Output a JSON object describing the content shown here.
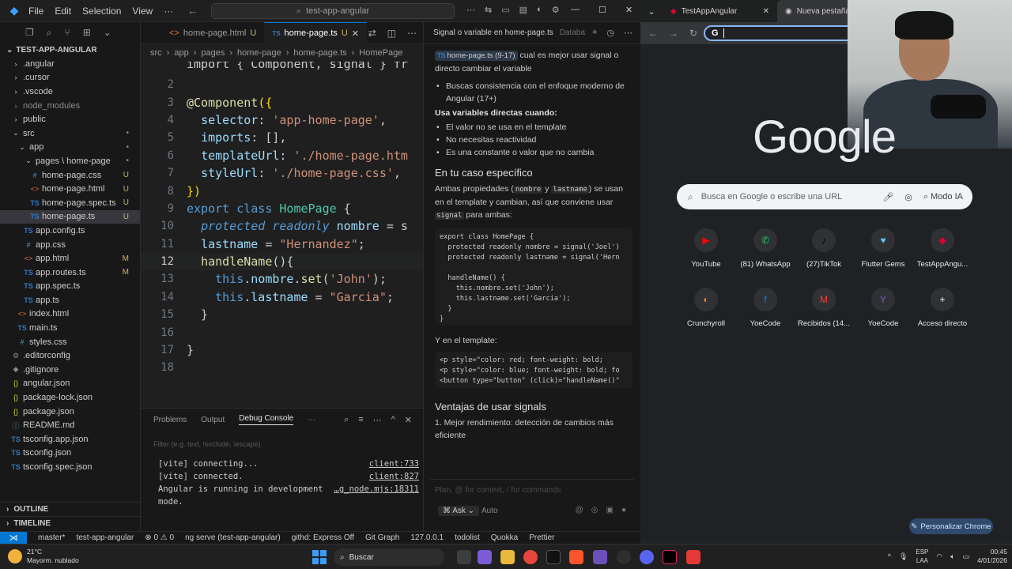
{
  "vscode": {
    "menu": [
      "File",
      "Edit",
      "Selection",
      "View"
    ],
    "command_center": "test-app-angular",
    "tabs": [
      {
        "label": "home-page.html",
        "mark": "U",
        "type": "html"
      },
      {
        "label": "home-page.ts",
        "mark": "U",
        "type": "ts",
        "active": true
      }
    ],
    "breadcrumb": [
      "src",
      "app",
      "pages",
      "home-page",
      "home-page.ts",
      "HomePage"
    ],
    "explorer": {
      "root": "TEST-APP-ANGULAR",
      "items": [
        {
          "label": ".angular",
          "depth": 1,
          "kind": "folder"
        },
        {
          "label": ".cursor",
          "depth": 1,
          "kind": "folder"
        },
        {
          "label": ".vscode",
          "depth": 1,
          "kind": "folder"
        },
        {
          "label": "node_modules",
          "depth": 1,
          "kind": "folder",
          "dim": true
        },
        {
          "label": "public",
          "depth": 1,
          "kind": "folder"
        },
        {
          "label": "src",
          "depth": 1,
          "kind": "folder-open",
          "badge": "•"
        },
        {
          "label": "app",
          "depth": 2,
          "kind": "folder-open",
          "badge": "•"
        },
        {
          "label": "pages \\ home-page",
          "depth": 3,
          "kind": "folder-open",
          "badge": "•"
        },
        {
          "label": "home-page.css",
          "depth": 4,
          "kind": "css",
          "badge": "U"
        },
        {
          "label": "home-page.html",
          "depth": 4,
          "kind": "html",
          "badge": "U"
        },
        {
          "label": "home-page.spec.ts",
          "depth": 4,
          "kind": "ts",
          "badge": "U"
        },
        {
          "label": "home-page.ts",
          "depth": 4,
          "kind": "ts",
          "badge": "U",
          "active": true
        },
        {
          "label": "app.config.ts",
          "depth": 3,
          "kind": "ts"
        },
        {
          "label": "app.css",
          "depth": 3,
          "kind": "css"
        },
        {
          "label": "app.html",
          "depth": 3,
          "kind": "html",
          "badge": "M"
        },
        {
          "label": "app.routes.ts",
          "depth": 3,
          "kind": "ts",
          "badge": "M"
        },
        {
          "label": "app.spec.ts",
          "depth": 3,
          "kind": "ts"
        },
        {
          "label": "app.ts",
          "depth": 3,
          "kind": "ts"
        },
        {
          "label": "index.html",
          "depth": 2,
          "kind": "html"
        },
        {
          "label": "main.ts",
          "depth": 2,
          "kind": "ts"
        },
        {
          "label": "styles.css",
          "depth": 2,
          "kind": "css"
        },
        {
          "label": ".editorconfig",
          "depth": 1,
          "kind": "gear"
        },
        {
          "label": ".gitignore",
          "depth": 1,
          "kind": "git"
        },
        {
          "label": "angular.json",
          "depth": 1,
          "kind": "json"
        },
        {
          "label": "package-lock.json",
          "depth": 1,
          "kind": "json"
        },
        {
          "label": "package.json",
          "depth": 1,
          "kind": "json"
        },
        {
          "label": "README.md",
          "depth": 1,
          "kind": "md"
        },
        {
          "label": "tsconfig.app.json",
          "depth": 1,
          "kind": "tsconfig"
        },
        {
          "label": "tsconfig.json",
          "depth": 1,
          "kind": "tsconfig"
        },
        {
          "label": "tsconfig.spec.json",
          "depth": 1,
          "kind": "tsconfig"
        }
      ],
      "outline": "OUTLINE",
      "timeline": "TIMELINE"
    },
    "code": {
      "top_partial": "import { Component, signal } fr",
      "current_line": 12,
      "lines": [
        {
          "n": 2,
          "html": ""
        },
        {
          "n": 3,
          "html": "<span class='d'>@Component</span><span class='b'>({</span>"
        },
        {
          "n": 4,
          "html": "  <span class='p'>selector</span>: <span class='s'>'app-home-page'</span>,"
        },
        {
          "n": 5,
          "html": "  <span class='p'>imports</span>: [],"
        },
        {
          "n": 6,
          "html": "  <span class='p'>templateUrl</span>: <span class='s'>'./home-page.htm</span>"
        },
        {
          "n": 7,
          "html": "  <span class='p'>styleUrl</span>: <span class='s'>'./home-page.css'</span>,"
        },
        {
          "n": 8,
          "html": "<span class='b'>})</span>"
        },
        {
          "n": 9,
          "html": "<span class='k'>export</span> <span class='k'>class</span> <span class='c'>HomePage</span> {"
        },
        {
          "n": 10,
          "html": "  <span class='i'>protected</span> <span class='i'>readonly</span> <span class='p'>nombre</span> = s"
        },
        {
          "n": 11,
          "html": "  <span class='p'>lastname</span> = <span class='s'>\"Hernandez\"</span>;"
        },
        {
          "n": 12,
          "html": "  <span class='f'>handleName</span>(){"
        },
        {
          "n": 13,
          "html": "    <span class='k'>this</span>.<span class='p'>nombre</span>.<span class='f'>set</span>(<span class='s'>'John'</span>);"
        },
        {
          "n": 14,
          "html": "    <span class='k'>this</span>.<span class='p'>lastname</span> = <span class='s'>\"Garcia\"</span>;"
        },
        {
          "n": 15,
          "html": "  }"
        },
        {
          "n": 16,
          "html": ""
        },
        {
          "n": 17,
          "html": "}"
        },
        {
          "n": 18,
          "html": ""
        }
      ]
    },
    "panel": {
      "tabs": [
        "Problems",
        "Output",
        "Debug Console"
      ],
      "active_tab": "Debug Console",
      "filter_placeholder": "Filter (e.g. text, !exclude, \\escape)",
      "output": [
        {
          "text": "[vite] connecting...",
          "link": "client:733"
        },
        {
          "text": "[vite] connected.",
          "link": "client:827"
        },
        {
          "text": "Angular is running in development",
          "link": "…g_node.mjs:18311"
        },
        {
          "text": "mode.",
          "link": ""
        }
      ]
    },
    "chat": {
      "title": "Signal o variable en home-page.ts",
      "title_extra": "Databa",
      "ref_chip": "home-page.ts (9-17)",
      "question": "cual es mejor usar signal o directo cambiar el variable",
      "bullets1": [
        "Buscas consistencia con el enfoque moderno de Angular (17+)"
      ],
      "heading_direct": "Usa variables directas cuando:",
      "bullets2": [
        "El valor no se usa en el template",
        "No necesitas reactividad",
        "Es una constante o valor que no cambia"
      ],
      "heading_case": "En tu caso específico",
      "para_case_1": "Ambas propiedades (",
      "code_nombre": "nombre",
      "para_and": " y ",
      "code_lastname": "lastname",
      "para_case_2": ") se usan en el template y cambian, así que conviene usar ",
      "code_signal": "signal",
      "para_case_3": " para ambas:",
      "code_block_1": "export class HomePage {\n  protected readonly nombre = signal('Joel')\n  protected readonly lastname = signal('Hern\n\n  handleName() {\n    this.nombre.set('John');\n    this.lastname.set('Garcia');\n  }\n}",
      "template_label": "Y en el template:",
      "code_block_2": "<p style=\"color: red; font-weight: bold;\n<p style=\"color: blue; font-weight: bold; fo\n<button type=\"button\" (click)=\"handleName()\"",
      "heading_adv": "Ventajas de usar signals",
      "adv_1": "1. Mejor rendimiento: detección de cambios más eficiente",
      "composer_placeholder": "Plan, @ for context, / for commands",
      "mode": "Ask",
      "model": "Auto"
    },
    "status": [
      "master*",
      "test-app-angular",
      "⊗ 0  ⚠ 0",
      "ng serve (test-app-angular)",
      "githd: Express Off",
      "Git Graph",
      "127.0.0.1",
      "todolist",
      "Quokka",
      "Prettier"
    ]
  },
  "browser": {
    "tabs": [
      {
        "label": "TestAppAngular"
      },
      {
        "label": "Nueva pestaña",
        "active": true
      }
    ],
    "search_placeholder": "Busca en Google o escribe una URL",
    "ai_mode": "Modo IA",
    "logo_text": "Google",
    "shortcuts_row1": [
      "YouTube",
      "(81) WhatsApp",
      "(27)TikTok",
      "Flutter Gems",
      "TestAppAngu..."
    ],
    "shortcuts_row2": [
      "Crunchyroll",
      "YoeCode",
      "Recibidos (14...",
      "YoeCode",
      "Acceso directo"
    ],
    "customize": "Personalizar Chrome"
  },
  "taskbar": {
    "temp": "21°C",
    "weather": "Mayorm. nublado",
    "search": "Buscar",
    "lang1": "ESP",
    "lang2": "LAA",
    "time": "00:45",
    "date": "4/01/2026"
  },
  "colors": {
    "accent": "#0078d4",
    "untracked": "#c9b464",
    "ts": "#3178c6"
  }
}
